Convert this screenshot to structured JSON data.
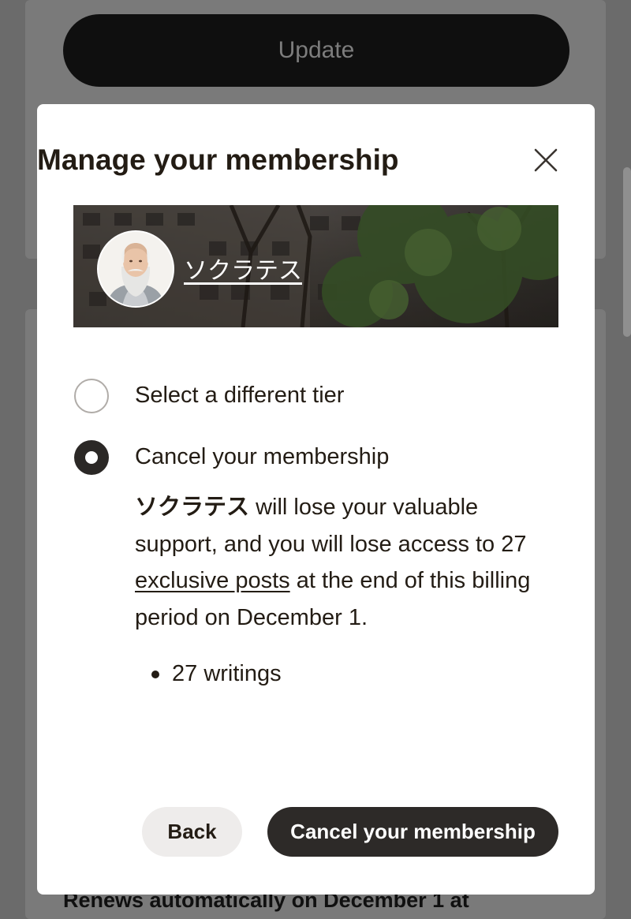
{
  "background": {
    "update_button_label": "Update",
    "renews_text": "Renews automatically on December 1 at"
  },
  "modal": {
    "title": "Manage your membership",
    "close_icon": "close-icon",
    "creator": {
      "name": "ソクラテス",
      "avatar_icon": "socrates-bust-avatar"
    },
    "options": [
      {
        "label": "Select a different tier",
        "selected": false
      },
      {
        "label": "Cancel your membership",
        "selected": true
      }
    ],
    "description": {
      "creator_name": "ソクラテス",
      "part1": " will lose your valuable support, and you will lose access to 27 ",
      "link_text": "exclusive posts",
      "part2": " at the end of this billing period on December 1."
    },
    "benefits": [
      "27 writings"
    ],
    "buttons": {
      "back_label": "Back",
      "cancel_label": "Cancel your membership"
    }
  },
  "colors": {
    "overlay_bg": "#6b6b6b",
    "primary_dark": "#2d2a28",
    "secondary_button": "#eeeceb",
    "text": "#231c14"
  }
}
